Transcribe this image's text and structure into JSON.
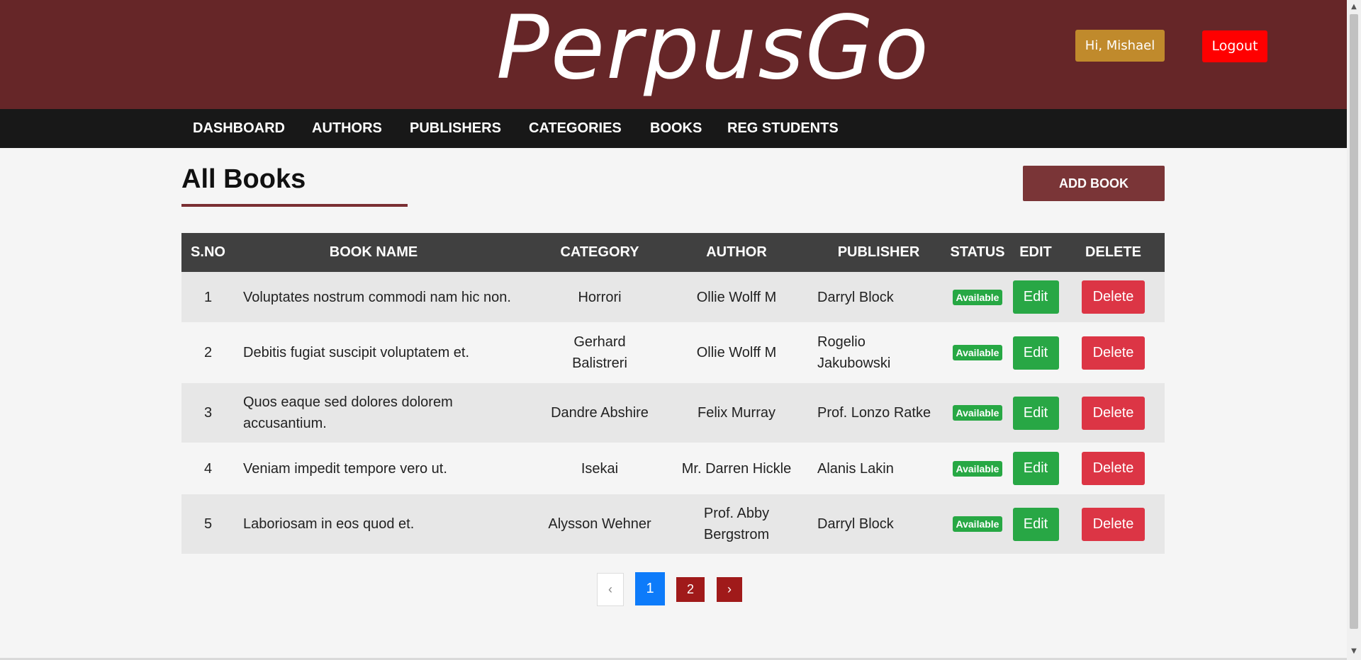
{
  "header": {
    "brand": "PerpusGo",
    "greeting": "Hi, Mishael",
    "logout_label": "Logout"
  },
  "nav": {
    "items": [
      {
        "label": "DASHBOARD"
      },
      {
        "label": "AUTHORS"
      },
      {
        "label": "PUBLISHERS"
      },
      {
        "label": "CATEGORIES"
      },
      {
        "label": "BOOKS"
      },
      {
        "label": "REG STUDENTS"
      }
    ]
  },
  "main": {
    "title": "All Books",
    "add_label": "ADD BOOK"
  },
  "table": {
    "headers": [
      "S.NO",
      "BOOK NAME",
      "CATEGORY",
      "AUTHOR",
      "PUBLISHER",
      "STATUS",
      "EDIT",
      "DELETE"
    ],
    "rows": [
      {
        "no": "1",
        "name": "Voluptates nostrum commodi nam hic non.",
        "category": "Horrori",
        "author": "Ollie Wolff M",
        "publisher": "Darryl Block",
        "status": "Available",
        "edit": "Edit",
        "delete": "Delete"
      },
      {
        "no": "2",
        "name": "Debitis fugiat suscipit voluptatem et.",
        "category": "Gerhard Balistreri",
        "author": "Ollie Wolff M",
        "publisher": "Rogelio Jakubowski",
        "status": "Available",
        "edit": "Edit",
        "delete": "Delete"
      },
      {
        "no": "3",
        "name": "Quos eaque sed dolores dolorem accusantium.",
        "category": "Dandre Abshire",
        "author": "Felix Murray",
        "publisher": "Prof. Lonzo Ratke",
        "status": "Available",
        "edit": "Edit",
        "delete": "Delete"
      },
      {
        "no": "4",
        "name": "Veniam impedit tempore vero ut.",
        "category": "Isekai",
        "author": "Mr. Darren Hickle",
        "publisher": "Alanis Lakin",
        "status": "Available",
        "edit": "Edit",
        "delete": "Delete"
      },
      {
        "no": "5",
        "name": "Laboriosam in eos quod et.",
        "category": "Alysson Wehner",
        "author": "Prof. Abby Bergstrom",
        "publisher": "Darryl Block",
        "status": "Available",
        "edit": "Edit",
        "delete": "Delete"
      }
    ]
  },
  "pagination": {
    "prev": "‹",
    "pages": [
      "1",
      "2"
    ],
    "next": "›",
    "current_page": "1"
  },
  "colors": {
    "header_bg": "#662628",
    "nav_bg": "#181818",
    "greeting_bg": "#c08a2c",
    "logout_bg": "#ff0000",
    "table_head_bg": "#404040",
    "available": "#27a844",
    "edit": "#28a745",
    "delete": "#dc3545",
    "page_active": "#0d7bfa",
    "page_other": "#a01a1a"
  }
}
